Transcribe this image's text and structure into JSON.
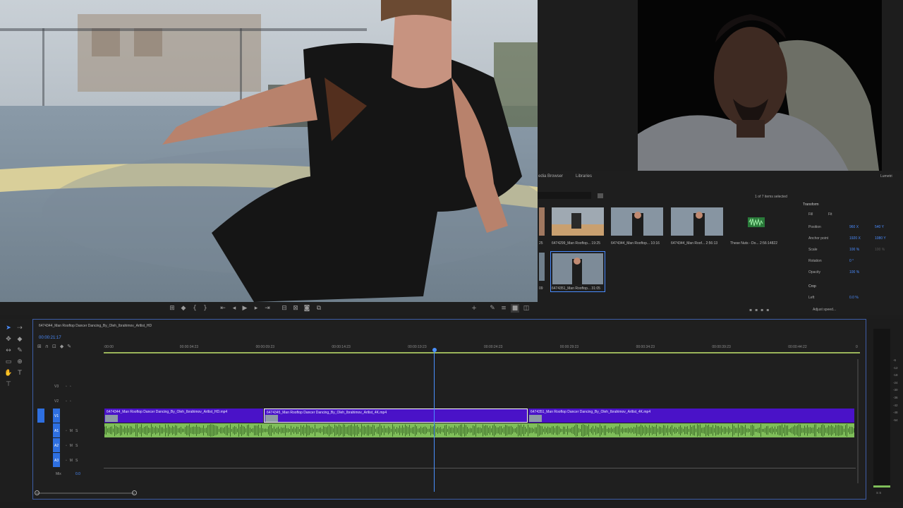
{
  "program_monitor": {
    "transport_icons": [
      "marker-icon",
      "mark-in-icon",
      "mark-out-icon",
      "go-to-in-icon",
      "step-back-icon",
      "play-icon",
      "step-forward-icon",
      "go-to-out-icon",
      "lift-icon",
      "extract-icon",
      "export-frame-icon",
      "compare-icon"
    ]
  },
  "project_panel": {
    "tab_media_browser": "edia Browser",
    "tab_libraries": "Libraries",
    "items_selected": "1 of 7 items selected",
    "items": [
      {
        "caption": "25"
      },
      {
        "caption": "6474299_Man Rooftop... 19:25"
      },
      {
        "caption": "6474344_Man Rooftop... 10:16"
      },
      {
        "caption": "6474344_Man Roof... 2:56:13"
      },
      {
        "caption": "These Nuts - Do... 2:56:14822"
      },
      {
        "caption": "09"
      },
      {
        "caption": "6474351_Man Rooftop... 31:05"
      }
    ]
  },
  "effect_controls": {
    "tab_lumetri": "Lumetri",
    "section_transform": "Transform",
    "fill_label": "Fill",
    "fit_label": "Fit",
    "props": [
      {
        "label": "Position",
        "value": "960 X",
        "value2": "540 Y"
      },
      {
        "label": "Anchor point",
        "value": "1920 X",
        "value2": "1080 Y"
      },
      {
        "label": "Scale",
        "value": "100 %",
        "value2": "100 %"
      },
      {
        "label": "Rotation",
        "value": "0 °",
        "value2": ""
      },
      {
        "label": "Opacity",
        "value": "100 %",
        "value2": ""
      }
    ],
    "section_crop": "Crop",
    "crop_left_label": "Left",
    "crop_left_value": "0.0 %",
    "adjust_speed": "Adjust speed..."
  },
  "timeline": {
    "sequence_name": "6474344_Man Rooftop Dancer Dancing_By_Oleh_Ibrahimov_Artlist_HD",
    "timecode": "00:00:21:17",
    "ruler_labels": [
      ":00:00",
      "00:00:04:23",
      "00:00:09:23",
      "00:00:14:23",
      "00:00:19:23",
      "00:00:24:23",
      "00:00:29:23",
      "00:00:34:23",
      "00:00:39:23",
      "00:00:44:22",
      "0"
    ],
    "tracks": {
      "video": [
        "V3",
        "V2",
        "V1"
      ],
      "audio": [
        "A1",
        "A2",
        "A3"
      ],
      "mix_label": "Mix",
      "mix_value": "0.0"
    },
    "clips": [
      {
        "name": "6474344_Man Rooftop Dancer Dancing_By_Oleh_Ibrahimov_Artlist_HD.mp4"
      },
      {
        "name": "6474345_Man Rooftop Dancer Dancing_By_Oleh_Ibrahimov_Artlist_4K.mp4"
      },
      {
        "name": "6474351_Man Rooftop Dancer Dancing_By_Oleh_Ibrahimov_Artlist_4K.mp4"
      }
    ]
  },
  "audio_meters": {
    "ticks": [
      "-6",
      "-12",
      "-18",
      "-24",
      "-30",
      "-36",
      "-42",
      "-48",
      "-54"
    ],
    "footer": "S  S"
  },
  "colors": {
    "clip_purple": "#4a12c8",
    "audio_green": "#7fbe5a",
    "accent_blue": "#2e6fe0",
    "playhead": "#4a90ff"
  }
}
